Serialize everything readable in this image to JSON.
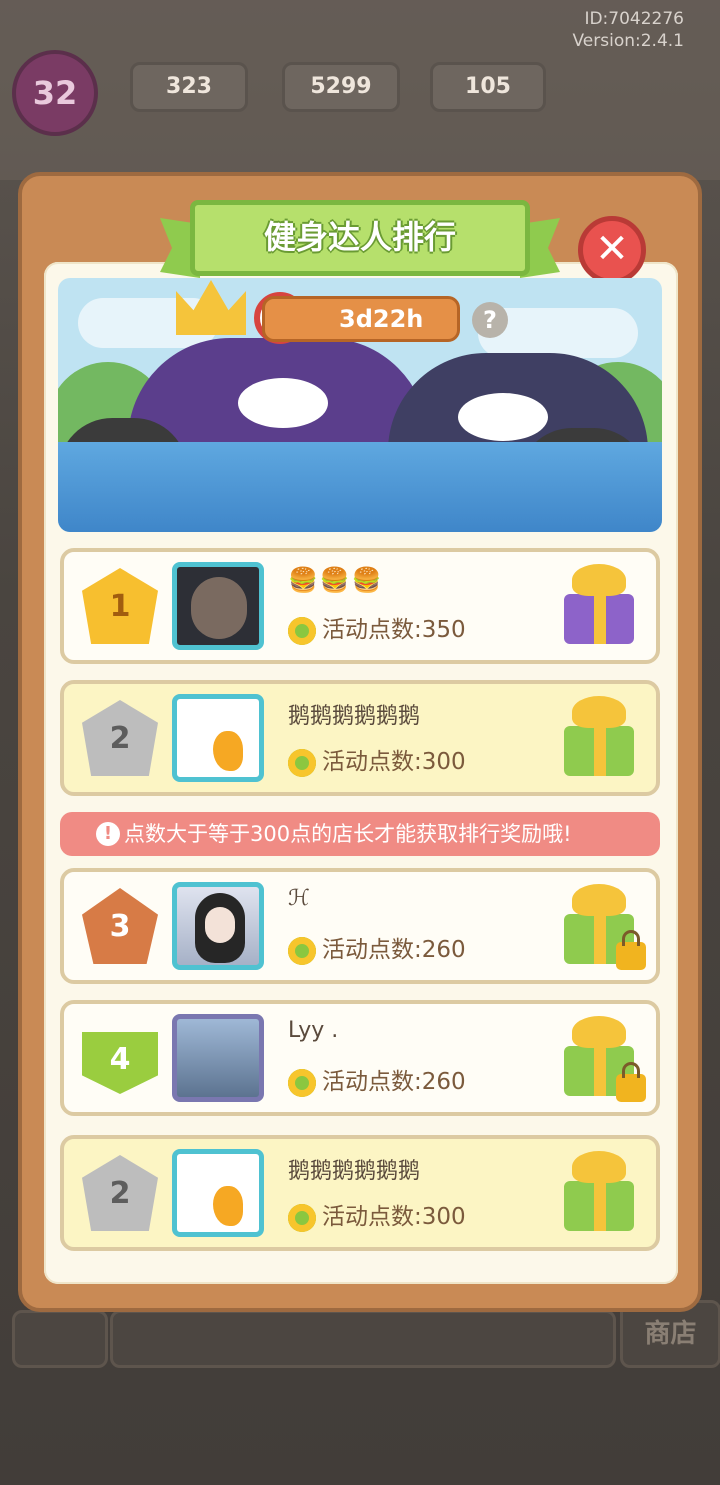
{
  "meta": {
    "id": "ID:7042276",
    "version": "Version:2.4.1"
  },
  "hud": {
    "level": "32",
    "energy": "323",
    "coins": "5299",
    "gems": "105"
  },
  "panel": {
    "title": "健身达人排行",
    "timer": "3d22h",
    "help": "?"
  },
  "notice": "点数大于等于300点的店长才能获取排行奖励哦!",
  "points_prefix": "活动点数:",
  "rows": [
    {
      "rank": "1",
      "name": "🍔🍔🍔",
      "points": "活动点数:350",
      "gift": "purple",
      "locked": false
    },
    {
      "rank": "2",
      "name": "鹅鹅鹅鹅鹅鹅",
      "points": "活动点数:300",
      "gift": "green",
      "locked": false
    },
    {
      "rank": "3",
      "name": "ℋ",
      "points": "活动点数:260",
      "gift": "green",
      "locked": true
    },
    {
      "rank": "4",
      "name": "Lyy .",
      "points": "活动点数:260",
      "gift": "green",
      "locked": true
    },
    {
      "rank": "2",
      "name": "鹅鹅鹅鹅鹅鹅",
      "points": "活动点数:300",
      "gift": "green",
      "locked": false
    }
  ],
  "background": {
    "shop_label": "商店"
  },
  "colors": {
    "panel": "#c98a55",
    "title_green": "#b6e06c",
    "close_red": "#e9524f",
    "notice": "#f08b84"
  }
}
